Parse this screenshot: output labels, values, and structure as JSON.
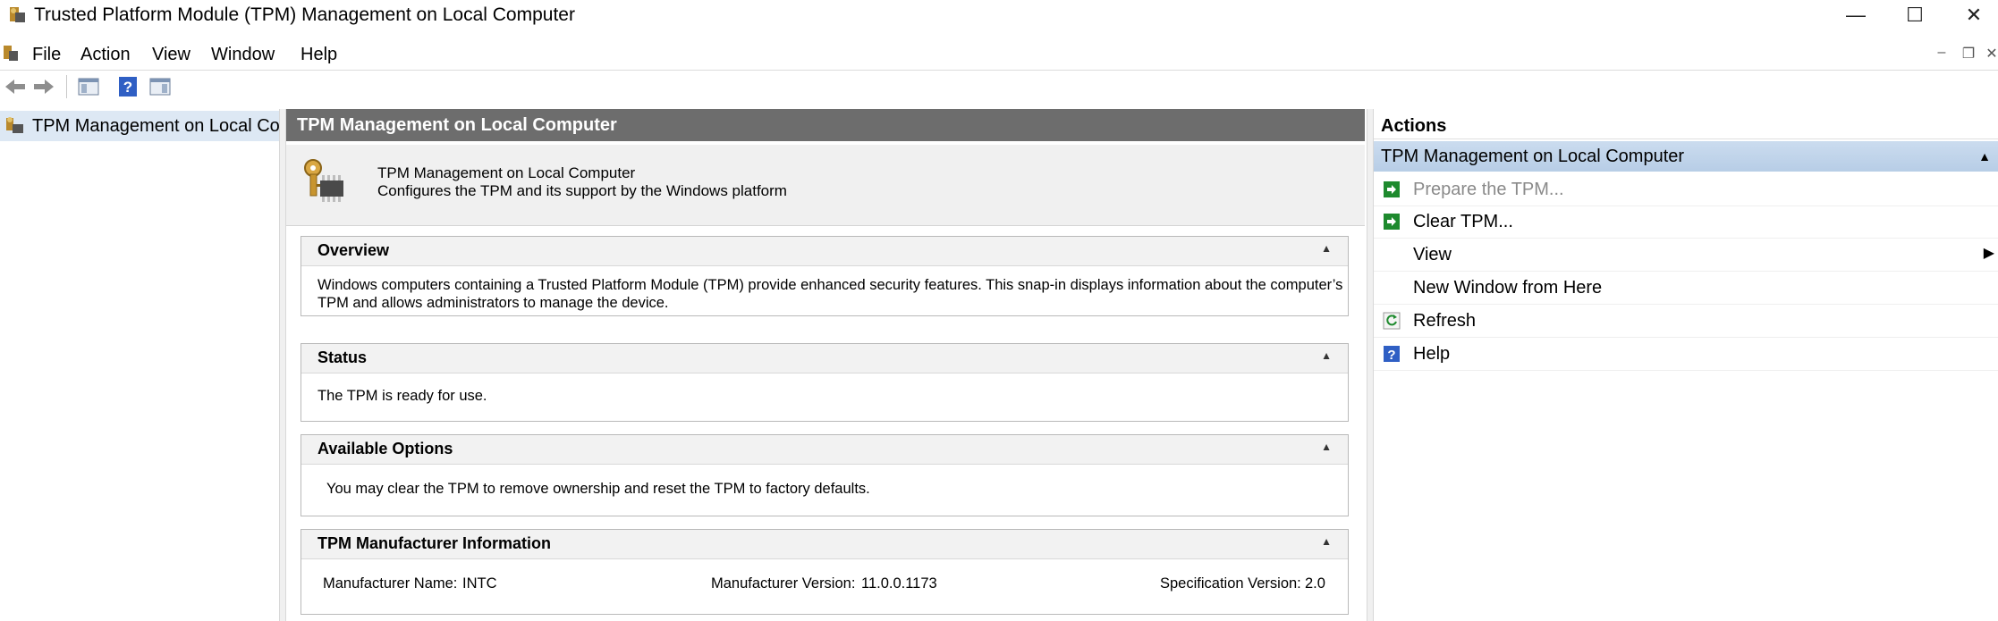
{
  "window": {
    "title": "Trusted Platform Module (TPM) Management on Local Computer",
    "minimize_glyph": "—",
    "maximize_glyph": "☐",
    "close_glyph": "✕"
  },
  "menu": {
    "items": [
      "File",
      "Action",
      "View",
      "Window",
      "Help"
    ]
  },
  "tree": {
    "root_label": "TPM Management on Local Co"
  },
  "center": {
    "header": "TPM Management on Local Computer",
    "intro_title": "TPM Management on Local Computer",
    "intro_desc": "Configures the TPM and its support by the Windows platform",
    "sections": {
      "overview": {
        "title": "Overview",
        "text_line1": "Windows computers containing a Trusted Platform Module (TPM) provide enhanced security features. This snap-in displays information about the computer’s",
        "text_line2": "TPM and allows administrators to manage the device."
      },
      "status": {
        "title": "Status",
        "text": "The TPM is ready for use."
      },
      "options": {
        "title": "Available Options",
        "text": "You may clear the TPM to remove ownership and reset the TPM to factory defaults."
      },
      "manufacturer": {
        "title": "TPM Manufacturer Information",
        "name_label": "Manufacturer Name:",
        "name_value": "INTC",
        "version_label": "Manufacturer Version:",
        "version_value": "11.0.0.1173",
        "spec_label": "Specification Version:",
        "spec_value": "2.0"
      }
    }
  },
  "actions": {
    "header": "Actions",
    "group": "TPM Management on Local Computer",
    "items": [
      {
        "label": "Prepare the TPM...",
        "icon": "green-arrow-icon",
        "enabled": false
      },
      {
        "label": "Clear TPM...",
        "icon": "green-arrow-icon",
        "enabled": true
      },
      {
        "label": "View",
        "icon": "",
        "enabled": true
      },
      {
        "label": "New Window from Here",
        "icon": "",
        "enabled": true
      },
      {
        "label": "Refresh",
        "icon": "refresh-icon",
        "enabled": true
      },
      {
        "label": "Help",
        "icon": "help-icon",
        "enabled": true
      }
    ]
  },
  "colors": {
    "center_header_bg": "#6d6d6d",
    "selection_bg": "#dde8f4",
    "actions_group_bg": "#b7cde6",
    "action_icon_green": "#1e8a2e",
    "help_icon_blue": "#2f5fc4"
  }
}
